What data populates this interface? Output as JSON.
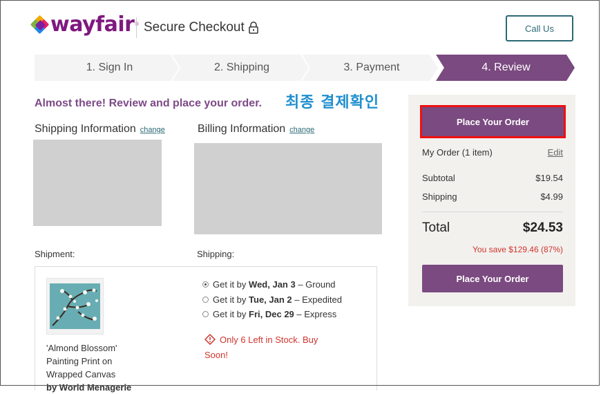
{
  "header": {
    "brand": "wayfair",
    "title": "Secure Checkout",
    "call_us": "Call Us"
  },
  "steps": [
    {
      "label": "1. Sign In",
      "active": false
    },
    {
      "label": "2. Shipping",
      "active": false
    },
    {
      "label": "3. Payment",
      "active": false
    },
    {
      "label": "4. Review",
      "active": true
    }
  ],
  "review": {
    "headline": "Almost there! Review and place your order.",
    "annotation": "최종 결제확인",
    "shipping_info_title": "Shipping Information",
    "billing_info_title": "Billing Information",
    "change_label": "change",
    "shipment_label": "Shipment:",
    "shipping_label": "Shipping:"
  },
  "product": {
    "name_line1": "'Almond Blossom'",
    "name_line2": "Painting Print on",
    "name_line3": "Wrapped Canvas",
    "by": "by World Menagerie"
  },
  "shipping_options": [
    {
      "prefix": "Get it by ",
      "date": "Wed, Jan 3",
      "suffix": " – Ground",
      "selected": true
    },
    {
      "prefix": "Get it by ",
      "date": "Tue, Jan 2",
      "suffix": " – Expedited",
      "selected": false
    },
    {
      "prefix": "Get it by ",
      "date": "Fri, Dec 29",
      "suffix": " – Express",
      "selected": false
    }
  ],
  "stock_warning": "Only 6 Left in Stock. Buy Soon!",
  "summary": {
    "place_order": "Place Your Order",
    "my_order": "My Order (1 item)",
    "edit": "Edit",
    "subtotal_label": "Subtotal",
    "subtotal": "$19.54",
    "shipping_label": "Shipping",
    "shipping": "$4.99",
    "total_label": "Total",
    "total": "$24.53",
    "savings": "You save $129.46 (87%)"
  },
  "colors": {
    "brand_purple": "#7f187f",
    "button_purple": "#7a4a80",
    "teal": "#2b6a76",
    "highlight_red": "#ee1111",
    "warning_red": "#d0342c",
    "annotation_blue": "#1f8fcf"
  }
}
